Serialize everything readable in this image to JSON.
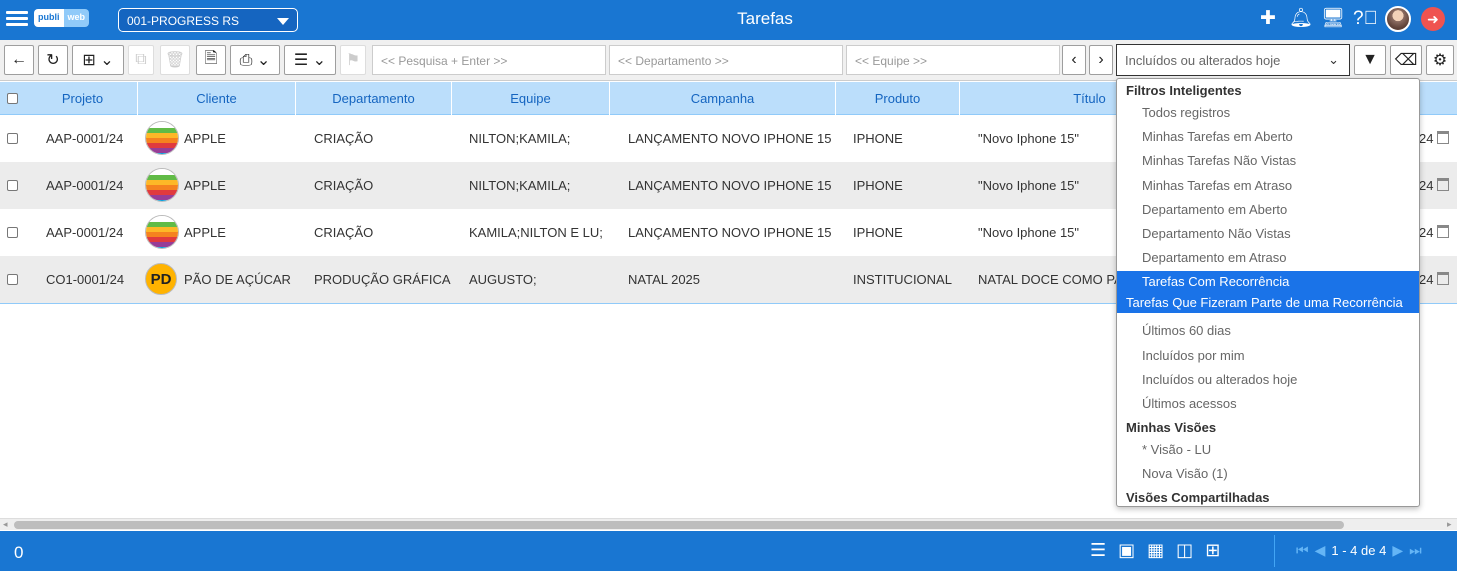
{
  "header": {
    "logo_a": "publi",
    "logo_b": "web",
    "company": "001-PROGRESS RS",
    "title": "Tarefas",
    "icons": [
      "plus-icon",
      "bell-icon",
      "monitor-icon",
      "help-icon",
      "avatar",
      "logout-icon"
    ]
  },
  "toolbar": {
    "search_placeholder": "<< Pesquisa + Enter >>",
    "department_placeholder": "<< Departamento >>",
    "team_placeholder": "<< Equipe >>",
    "view_selected": "Incluídos ou alterados hoje"
  },
  "table": {
    "columns": [
      "Projeto",
      "Cliente",
      "Departamento",
      "Equipe",
      "Campanha",
      "Produto",
      "Título"
    ],
    "rows": [
      {
        "projeto": "AAP-0001/24",
        "cliente": "APPLE",
        "departamento": "CRIAÇÃO",
        "equipe": "NILTON;KAMILA;",
        "campanha": "LANÇAMENTO NOVO IPHONE 15",
        "produto": "IPHONE",
        "titulo": "\"Novo Iphone 15\"",
        "tail": "24"
      },
      {
        "projeto": "AAP-0001/24",
        "cliente": "APPLE",
        "departamento": "CRIAÇÃO",
        "equipe": "NILTON;KAMILA;",
        "campanha": "LANÇAMENTO NOVO IPHONE 15",
        "produto": "IPHONE",
        "titulo": "\"Novo Iphone 15\"",
        "tail": "24"
      },
      {
        "projeto": "AAP-0001/24",
        "cliente": "APPLE",
        "departamento": "CRIAÇÃO",
        "equipe": "KAMILA;NILTON E LU;",
        "campanha": "LANÇAMENTO NOVO IPHONE 15",
        "produto": "IPHONE",
        "titulo": "\"Novo Iphone 15\"",
        "tail": "24"
      },
      {
        "projeto": "CO1-0001/24",
        "cliente": "PÃO DE AÇÚCAR",
        "cliente_initials": "PD",
        "departamento": "PRODUÇÃO GRÁFICA",
        "equipe": "AUGUSTO;",
        "campanha": "NATAL 2025",
        "produto": "INSTITUCIONAL",
        "titulo": "NATAL DOCE COMO PAO",
        "tail": "24"
      }
    ]
  },
  "dropdown": {
    "group1": "Filtros Inteligentes",
    "items1": [
      "Todos registros",
      "Minhas Tarefas em Aberto",
      "Minhas Tarefas Não Vistas",
      "Minhas Tarefas em Atraso",
      "Departamento em Aberto",
      "Departamento Não Vistas",
      "Departamento em Atraso",
      "Tarefas Com Recorrência",
      "Tarefas Que Fizeram Parte de uma Recorrência",
      "Últimos 60 dias",
      "Incluídos por mim",
      "Incluídos ou alterados hoje",
      "Últimos acessos"
    ],
    "group2": "Minhas Visões",
    "items2": [
      "* Visão - LU",
      "Nova Visão (1)"
    ],
    "group3": "Visões Compartilhadas"
  },
  "footer": {
    "count": "0",
    "pager_text": "1 - 4 de 4"
  },
  "colors": {
    "primary": "#1976d2",
    "header_row": "#bbdefb",
    "selected": "#1a73e8"
  }
}
